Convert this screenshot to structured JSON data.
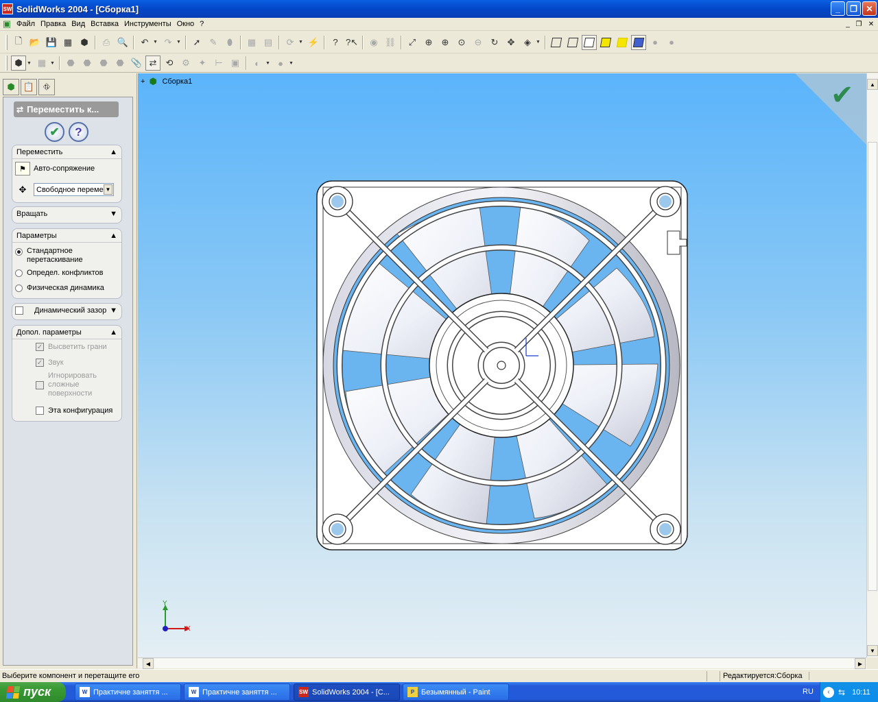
{
  "window": {
    "app_icon": "SW",
    "title": "SolidWorks 2004 - [Сборка1]"
  },
  "menu": [
    "Файл",
    "Правка",
    "Вид",
    "Вставка",
    "Инструменты",
    "Окно",
    "?"
  ],
  "tree": {
    "expand": "+",
    "root_label": "Сборка1"
  },
  "property_manager": {
    "title": "Переместить к...",
    "move_group": {
      "title": "Переместить",
      "auto_mate": "Авто-сопряжение",
      "mode_value": "Свободное перемещ"
    },
    "rotate_group": {
      "title": "Вращать"
    },
    "options_group": {
      "title": "Параметры",
      "standard_drag_line1": "Стандартное",
      "standard_drag_line2": "перетаскивание",
      "collision_detection": "Определ. конфликтов",
      "physical_dynamics": "Физическая динамика"
    },
    "dynamic_clearance": "Динамический зазор",
    "advanced_group": {
      "title": "Допол. параметры",
      "highlight_faces": "Высветить грани",
      "sound": "Звук",
      "ignore_line1": "Игнорировать",
      "ignore_line2": "сложные",
      "ignore_line3": "поверхности",
      "this_config": "Эта конфигурация"
    }
  },
  "triad": {
    "x": "X",
    "y": "Y"
  },
  "status": {
    "message": "Выберите компонент и перетащите его",
    "editing": "Редактируется:Сборка"
  },
  "taskbar": {
    "start": "пуск",
    "tasks": [
      {
        "icon": "W",
        "label": "Практичне заняття ..."
      },
      {
        "icon": "W",
        "label": "Практичне заняття ..."
      },
      {
        "icon": "SW",
        "label": "SolidWorks 2004 - [С..."
      },
      {
        "icon": "P",
        "label": "Безымянный - Paint"
      }
    ],
    "lang": "RU",
    "clock": "10:11"
  },
  "colors": {
    "accent": "#0a5fe0",
    "viewport_top": "#5bb4fb",
    "viewport_bottom": "#e4eef4",
    "ok_green": "#2e9a4e"
  }
}
